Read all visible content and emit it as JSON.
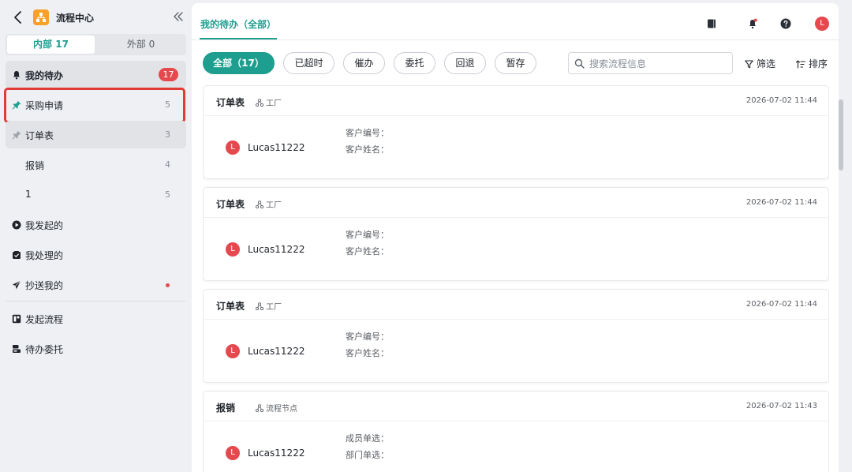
{
  "app": {
    "title": "流程中心",
    "icons": {
      "back": "chevron-left-icon",
      "logo": "flow-logo-icon",
      "collapse": "double-chevron-left-icon"
    }
  },
  "segments": {
    "internal": "内部 17",
    "external": "外部 0"
  },
  "sidebar": {
    "my_todo": {
      "label": "我的待办",
      "badge": "17",
      "icon": "bell-icon"
    },
    "pinned_items": [
      {
        "label": "采购申请",
        "count": "5",
        "icon": "pin-icon",
        "pin_color": "#1e9e8f"
      },
      {
        "label": "订单表",
        "count": "3",
        "icon": "pin-icon",
        "pin_color": "#a0a4ab"
      }
    ],
    "sub_items": [
      {
        "label": "报销",
        "count": "4"
      },
      {
        "label": "1",
        "count": "5"
      }
    ],
    "initiated": {
      "label": "我发起的",
      "icon": "play-circle-icon"
    },
    "processed": {
      "label": "我处理的",
      "icon": "inbox-icon"
    },
    "cc": {
      "label": "抄送我的",
      "icon": "send-icon",
      "has_dot": true
    },
    "start_flow": {
      "label": "发起流程",
      "icon": "grid-icon"
    },
    "delegate": {
      "label": "待办委托",
      "icon": "delegate-icon"
    }
  },
  "main": {
    "tab_label": "我的待办（全部）",
    "top_icons": [
      "book-icon",
      "notification-icon",
      "help-icon",
      "avatar"
    ],
    "avatar_letter": "L",
    "filters": [
      {
        "label": "全部（17）",
        "active": true
      },
      {
        "label": "已超时",
        "active": false
      },
      {
        "label": "催办",
        "active": false
      },
      {
        "label": "委托",
        "active": false
      },
      {
        "label": "回退",
        "active": false
      },
      {
        "label": "暂存",
        "active": false
      }
    ],
    "search": {
      "placeholder": "搜索流程信息",
      "value": ""
    },
    "filter_label": "筛选",
    "sort_label": "排序"
  },
  "cards": [
    {
      "title": "订单表",
      "node": "工厂",
      "time": "2026-07-02 11:44",
      "avatar": "L",
      "user": "Lucas11222",
      "field1": "客户编号：",
      "field2": "客户姓名："
    },
    {
      "title": "订单表",
      "node": "工厂",
      "time": "2026-07-02 11:44",
      "avatar": "L",
      "user": "Lucas11222",
      "field1": "客户编号：",
      "field2": "客户姓名："
    },
    {
      "title": "订单表",
      "node": "工厂",
      "time": "2026-07-02 11:44",
      "avatar": "L",
      "user": "Lucas11222",
      "field1": "客户编号：",
      "field2": "客户姓名："
    },
    {
      "title": "报销",
      "node": "流程节点",
      "time": "2026-07-02 11:43",
      "avatar": "L",
      "user": "Lucas11222",
      "field1": "成员单选：",
      "field2": "部门单选："
    }
  ],
  "colors": {
    "accent": "#1e9e8f",
    "badge": "#e5484d",
    "highlight_frame": "#e03b34"
  }
}
